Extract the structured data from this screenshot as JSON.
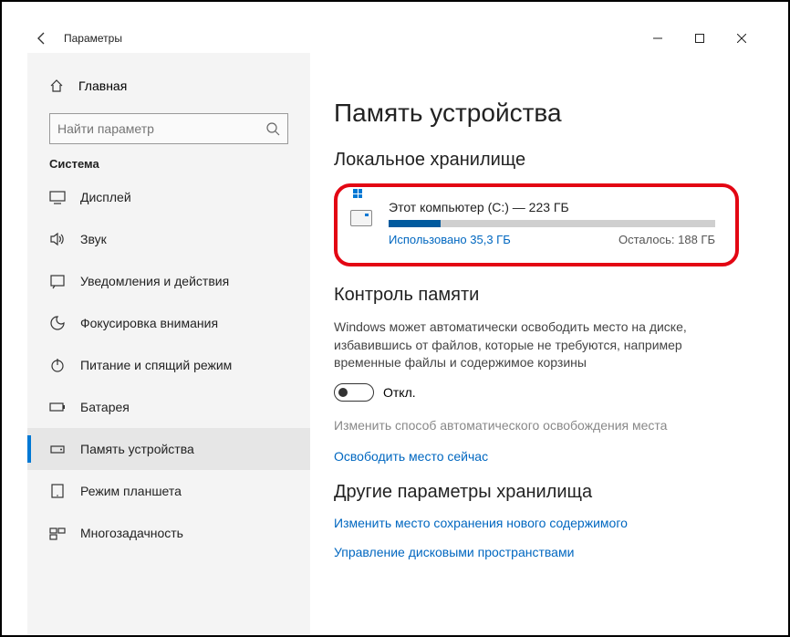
{
  "window": {
    "title": "Параметры"
  },
  "sidebar": {
    "home": "Главная",
    "search_placeholder": "Найти параметр",
    "section": "Система",
    "items": [
      {
        "label": "Дисплей"
      },
      {
        "label": "Звук"
      },
      {
        "label": "Уведомления и действия"
      },
      {
        "label": "Фокусировка внимания"
      },
      {
        "label": "Питание и спящий режим"
      },
      {
        "label": "Батарея"
      },
      {
        "label": "Память устройства"
      },
      {
        "label": "Режим планшета"
      },
      {
        "label": "Многозадачность"
      }
    ]
  },
  "content": {
    "page_title": "Память устройства",
    "local_storage_header": "Локальное хранилище",
    "drive": {
      "title": "Этот компьютер (C:) — 223 ГБ",
      "used": "Использовано 35,3 ГБ",
      "remaining": "Осталось: 188 ГБ"
    },
    "sense_header": "Контроль памяти",
    "sense_desc": "Windows может автоматически освободить место на диске, избавившись от файлов, которые не требуются, например временные файлы и содержимое корзины",
    "toggle_state": "Откл.",
    "link_change": "Изменить способ автоматического освобождения места",
    "link_free_now": "Освободить место сейчас",
    "other_header": "Другие параметры хранилища",
    "link_save_loc": "Изменить место сохранения нового содержимого",
    "link_spaces": "Управление дисковыми пространствами"
  }
}
